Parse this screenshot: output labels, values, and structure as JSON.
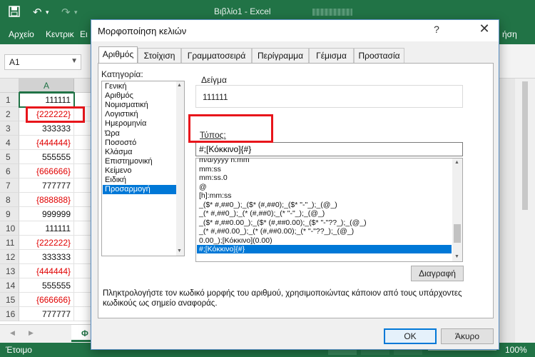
{
  "excel": {
    "app_title": "Βιβλίο1 - Excel",
    "ribbon_tabs": [
      "Αρχείο",
      "Κεντρικ",
      "Ει"
    ],
    "ribbon_tab_right": "ήση",
    "namebox": "A1",
    "column_header": "A",
    "rows": [
      {
        "num": "1",
        "value": "111111",
        "negative": false
      },
      {
        "num": "2",
        "value": "{222222}",
        "negative": true
      },
      {
        "num": "3",
        "value": "333333",
        "negative": false
      },
      {
        "num": "4",
        "value": "{444444}",
        "negative": true
      },
      {
        "num": "5",
        "value": "555555",
        "negative": false
      },
      {
        "num": "6",
        "value": "{666666}",
        "negative": true
      },
      {
        "num": "7",
        "value": "777777",
        "negative": false
      },
      {
        "num": "8",
        "value": "{888888}",
        "negative": true
      },
      {
        "num": "9",
        "value": "999999",
        "negative": false
      },
      {
        "num": "10",
        "value": "111111",
        "negative": false
      },
      {
        "num": "11",
        "value": "{222222}",
        "negative": true
      },
      {
        "num": "12",
        "value": "333333",
        "negative": false
      },
      {
        "num": "13",
        "value": "{444444}",
        "negative": true
      },
      {
        "num": "14",
        "value": "555555",
        "negative": false
      },
      {
        "num": "15",
        "value": "{666666}",
        "negative": true
      },
      {
        "num": "16",
        "value": "777777",
        "negative": false
      }
    ],
    "sheet_tab": "Φ",
    "status_ready": "Έτοιμο",
    "zoom": "100%"
  },
  "dialog": {
    "title": "Μορφοποίηση κελιών",
    "help": "?",
    "close": "✕",
    "tabs": [
      "Αριθμός",
      "Στοίχιση",
      "Γραμματοσειρά",
      "Περίγραμμα",
      "Γέμισμα",
      "Προστασία"
    ],
    "category_label": "Κατηγορία:",
    "categories": [
      "Γενική",
      "Αριθμός",
      "Νομισματική",
      "Λογιστική",
      "Ημερομηνία",
      "Ώρα",
      "Ποσοστό",
      "Κλάσμα",
      "Επιστημονική",
      "Κείμενο",
      "Ειδική",
      "Προσαρμογή"
    ],
    "selected_category": "Προσαρμογή",
    "sample_label": "Δείγμα",
    "sample_value": "111111",
    "type_label": "Τύπος:",
    "type_value": "#;[Κόκκινο]{#}",
    "formats": [
      "m/d/yyyy h:mm",
      "mm:ss",
      "mm:ss.0",
      "@",
      "[h]:mm:ss",
      "_($* #,##0_);_($* (#,##0);_($* \"-\"_);_(@_)",
      "_(* #,##0_);_(* (#,##0);_(* \"-\"_);_(@_)",
      "_($* #,##0.00_);_($* (#,##0.00);_($* \"-\"??_);_(@_)",
      "_(* #,##0.00_);_(* (#,##0.00);_(* \"-\"??_);_(@_)",
      "0.00_);[Κόκκινο](0.00)",
      "#;[Κόκκινο]{#}"
    ],
    "delete_label": "Διαγραφή",
    "description": "Πληκτρολογήστε τον κωδικό μορφής του αριθμού, χρησιμοποιώντας κάποιον από τους υπάρχοντες κωδικούς ως σημείο αναφοράς.",
    "ok_label": "OK",
    "cancel_label": "Άκυρο"
  },
  "colors": {
    "excel_green": "#217346",
    "highlight_red": "#e8151b",
    "selection_blue": "#0078d7"
  }
}
